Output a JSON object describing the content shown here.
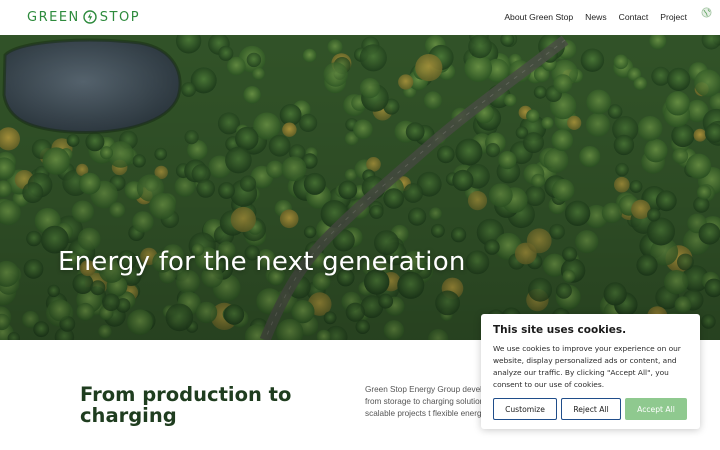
{
  "header": {
    "logo_left": "GREEN",
    "logo_right": "STOP",
    "nav": [
      {
        "label": "About Green Stop"
      },
      {
        "label": "News"
      },
      {
        "label": "Contact"
      },
      {
        "label": "Project"
      }
    ]
  },
  "hero": {
    "title": "Energy for the next generation"
  },
  "section": {
    "title": "From production to charging",
    "text": "Green Stop Energy Group develop infrastructure of the future – from storage to charging solutions for e supply through scalable projects t flexible energy system."
  },
  "cookie": {
    "title": "This site uses cookies.",
    "text": "We use cookies to improve your experience on our website, display personalized ads or content, and analyze our traffic. By clicking \"Accept All\", you consent to our use of cookies.",
    "customize_label": "Customize",
    "reject_label": "Reject All",
    "accept_label": "Accept All"
  },
  "colors": {
    "brand_green": "#2e8b3d",
    "accept_button": "#8fc98f",
    "button_border": "#1f4d8a",
    "section_title": "#1f3d1f"
  }
}
